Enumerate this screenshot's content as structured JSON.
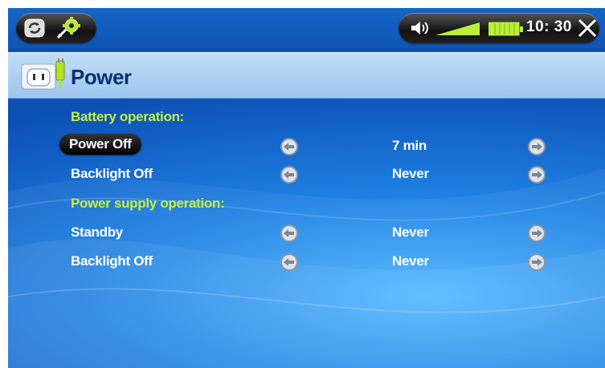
{
  "statusbar": {
    "left_icons": [
      "sync-icon",
      "settings-gear-icon"
    ],
    "right_icons": [
      "volume-icon",
      "volume-level-icon",
      "battery-icon",
      "close-icon"
    ],
    "clock": "10: 30",
    "battery_level": 1.0,
    "volume_level": 0.5
  },
  "header": {
    "icon": "power-plug-icon",
    "title": "Power"
  },
  "sections": [
    {
      "heading": "Battery operation:",
      "rows": [
        {
          "label": "Power Off",
          "value": "7 min",
          "selected": true
        },
        {
          "label": "Backlight Off",
          "value": "Never",
          "selected": false
        }
      ]
    },
    {
      "heading": "Power supply operation:",
      "rows": [
        {
          "label": "Standby",
          "value": "Never",
          "selected": false
        },
        {
          "label": "Backlight Off",
          "value": "Never",
          "selected": false
        }
      ]
    }
  ],
  "colors": {
    "section_heading": "#c4f23c",
    "title": "#0a2f6f",
    "background": "#1f82e4"
  }
}
